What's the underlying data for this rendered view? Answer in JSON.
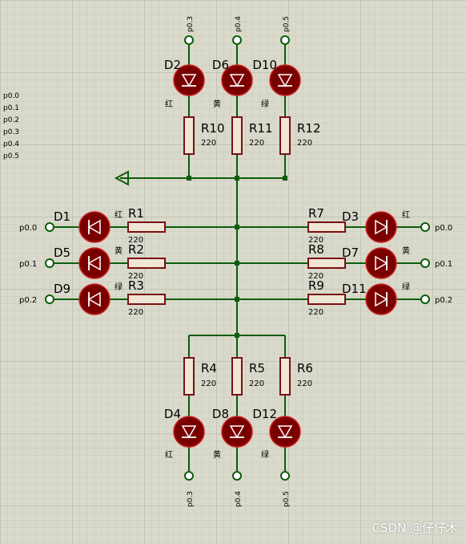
{
  "colors": {
    "background": "#d9d9cc",
    "grid_minor": "#c6c6b6",
    "grid_major": "#b0b0a0",
    "wire": "#0b5d0b",
    "resistor": "#7a1010",
    "led_fill": "#7a0000",
    "led_outline": "#cc2222",
    "pin": "#0b5d0b",
    "text": "#000000"
  },
  "watermark": "CSDN @仔仔木",
  "port_list": [
    "p0.0",
    "p0.1",
    "p0.2",
    "p0.3",
    "p0.4",
    "p0.5"
  ],
  "resistor_value": "220",
  "top_group": {
    "pins": [
      "p0.3",
      "p0.4",
      "p0.5"
    ],
    "leds": [
      "D2",
      "D6",
      "D10"
    ],
    "colors": [
      "红",
      "黄",
      "绿"
    ],
    "resistors": [
      "R10",
      "R11",
      "R12"
    ]
  },
  "bottom_group": {
    "pins": [
      "p0.3",
      "p0.4",
      "p0.5"
    ],
    "leds": [
      "D4",
      "D8",
      "D12"
    ],
    "colors": [
      "红",
      "黄",
      "绿"
    ],
    "resistors": [
      "R4",
      "R5",
      "R6"
    ]
  },
  "left_group": {
    "pins": [
      "p0.0",
      "p0.1",
      "p0.2"
    ],
    "leds": [
      "D1",
      "D5",
      "D9"
    ],
    "colors": [
      "红",
      "黄",
      "绿"
    ],
    "resistors": [
      "R1",
      "R2",
      "R3"
    ]
  },
  "right_group": {
    "pins": [
      "p0.0",
      "p0.1",
      "p0.2"
    ],
    "leds": [
      "D3",
      "D7",
      "D11"
    ],
    "colors": [
      "红",
      "黄",
      "绿"
    ],
    "resistors": [
      "R7",
      "R8",
      "R9"
    ]
  },
  "icons": {
    "led": "led-diode-icon",
    "ground": "ground-arrow-icon",
    "terminal": "pin-terminal-icon"
  }
}
